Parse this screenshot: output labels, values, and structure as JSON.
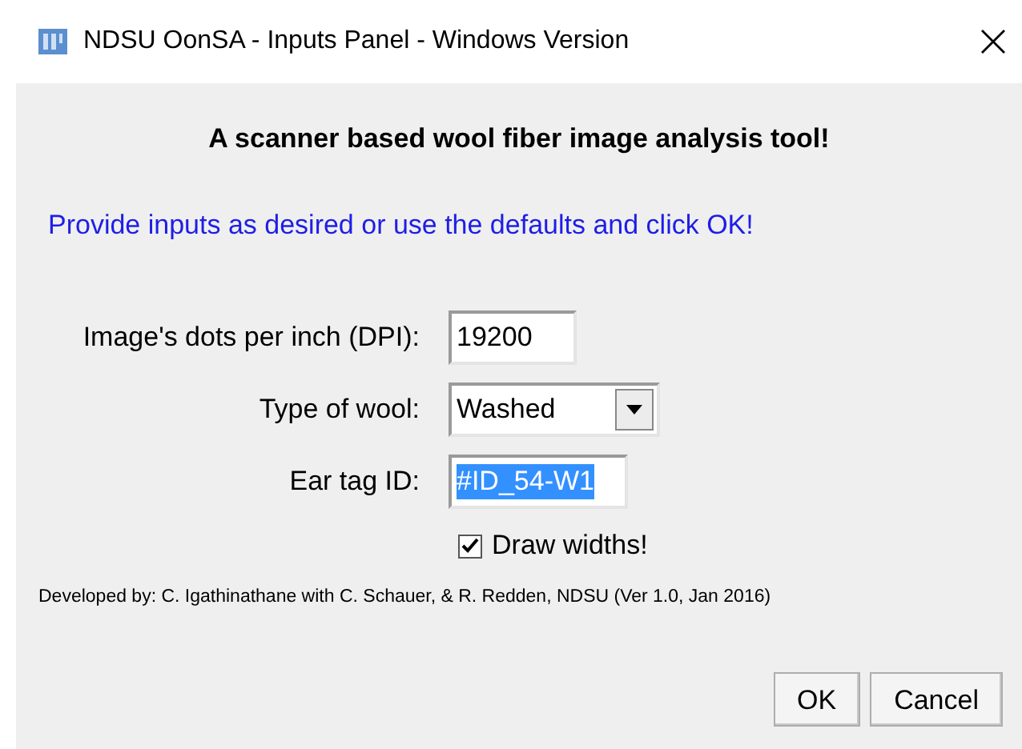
{
  "window": {
    "title": "NDSU OonSA - Inputs Panel - Windows Version"
  },
  "heading": "A scanner based wool fiber image analysis tool!",
  "instructions": "Provide inputs as desired or use the defaults and click OK!",
  "fields": [
    {
      "kind": "text",
      "label": "Image's dots per inch (DPI):",
      "value": "19200",
      "text_selected": false
    },
    {
      "kind": "dropdown",
      "label": "Type of wool:",
      "value": "Washed"
    },
    {
      "kind": "text",
      "label": "Ear tag ID:",
      "value": "#ID_54-W1",
      "text_selected": true
    }
  ],
  "checkbox": {
    "label": "Draw widths!",
    "checked": true
  },
  "credits": "Developed by: C. Igathinathane with C. Schauer, & R. Redden, NDSU (Ver 1.0, Jan 2016)",
  "buttons": [
    "OK",
    "Cancel"
  ]
}
